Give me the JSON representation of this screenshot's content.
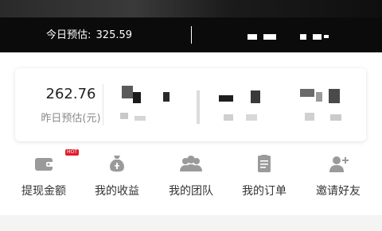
{
  "header": {
    "today_label": "今日预估:",
    "today_value": "325.59"
  },
  "stats": {
    "yesterday_value": "262.76",
    "yesterday_label": "昨日预估(元)"
  },
  "actions": [
    {
      "label": "提现金额",
      "icon": "wallet-icon",
      "badge": "HOT"
    },
    {
      "label": "我的收益",
      "icon": "money-bag-icon"
    },
    {
      "label": "我的团队",
      "icon": "team-icon"
    },
    {
      "label": "我的订单",
      "icon": "order-icon"
    },
    {
      "label": "邀请好友",
      "icon": "invite-friend-icon"
    }
  ],
  "colors": {
    "header_bg": "#0b0b0b",
    "icon_gray": "#9a9a9a",
    "badge_red": "#e21c2c"
  }
}
